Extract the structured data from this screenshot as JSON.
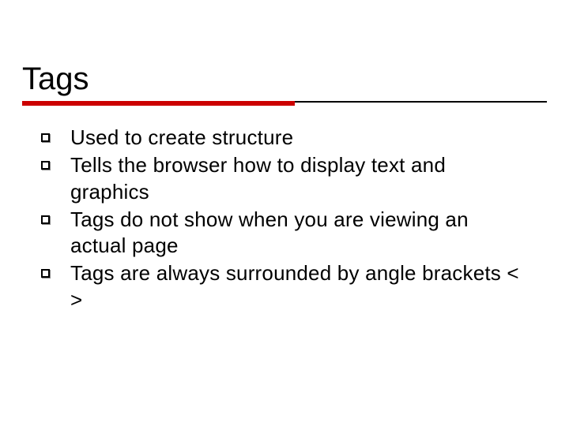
{
  "slide": {
    "title": "Tags",
    "bullets": [
      {
        "text": "Used to create structure"
      },
      {
        "text": "Tells the browser how to display text and graphics"
      },
      {
        "text": "Tags do not show when you are viewing an actual page"
      },
      {
        "text": "Tags are always surrounded by angle brackets <   >"
      }
    ],
    "accent_color": "#cc0000"
  }
}
